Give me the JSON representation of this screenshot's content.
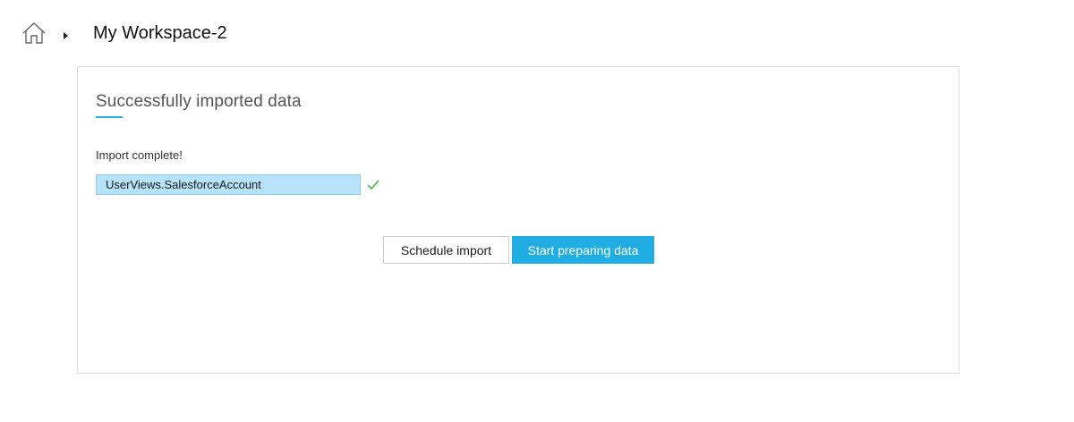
{
  "breadcrumb": {
    "home_icon": "home-icon",
    "separator_icon": "caret-right-icon",
    "workspace_title": "My Workspace-2"
  },
  "import_card": {
    "title": "Successfully imported data",
    "status": "Import complete!",
    "imported_table": "UserViews.SalesforceAccount",
    "success_icon": "checkmark-icon",
    "schedule_label": "Schedule import",
    "start_label": "Start preparing data"
  },
  "colors": {
    "accent": "#1fade4",
    "table_highlight": "#b6e3f9",
    "success": "#5cb85c"
  }
}
